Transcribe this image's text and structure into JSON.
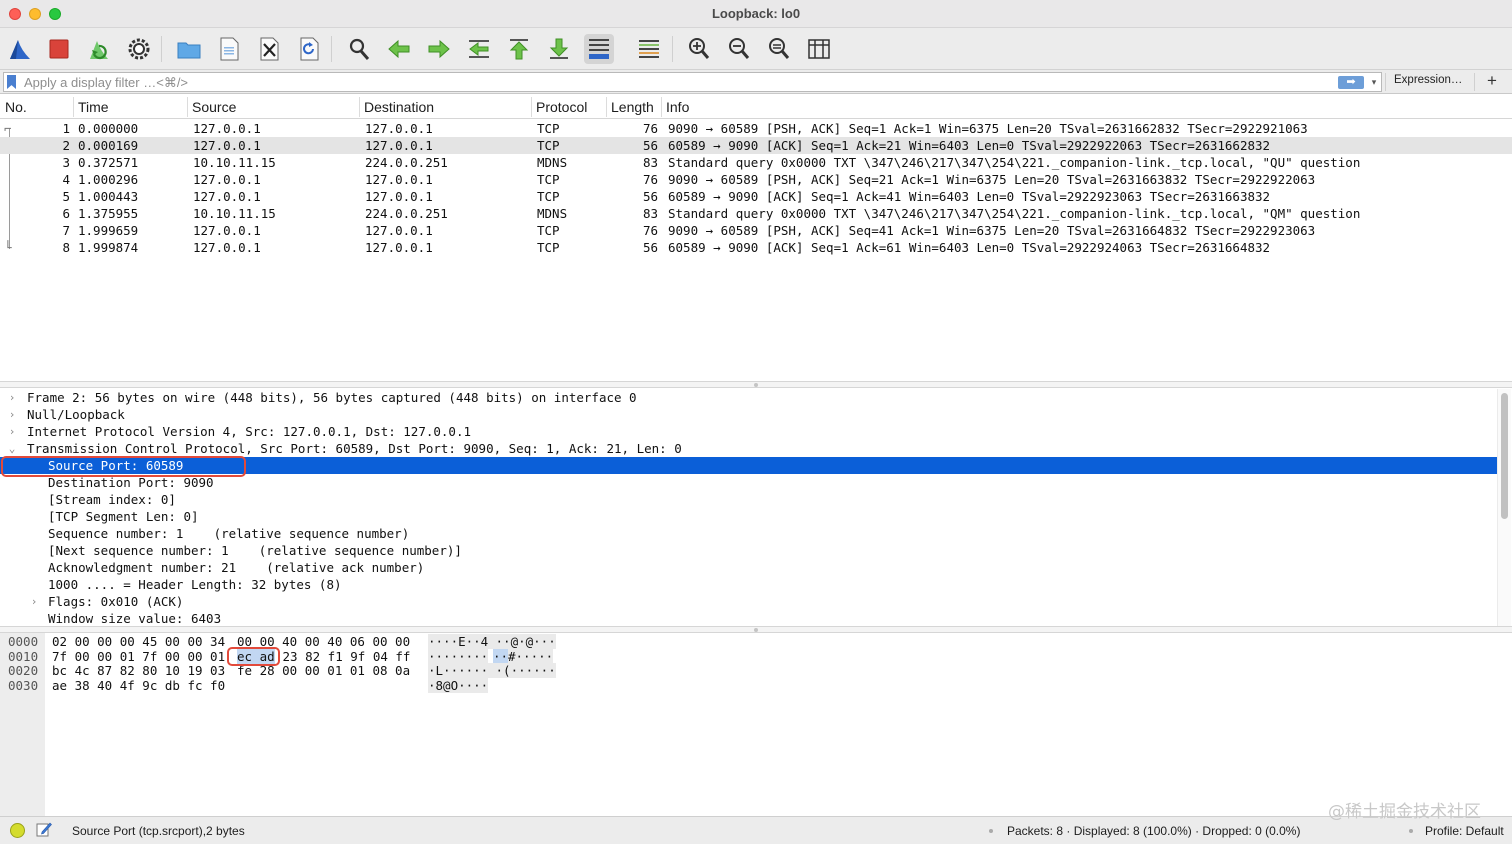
{
  "window": {
    "title": "Loopback: lo0"
  },
  "filter": {
    "placeholder": "Apply a display filter …<⌘/>",
    "value": "",
    "expression_label": "Expression…",
    "add_label": "+",
    "apply_label": "➡",
    "dropdown_label": "▾"
  },
  "packet_list": {
    "columns": [
      "No.",
      "Time",
      "Source",
      "Destination",
      "Protocol",
      "Length",
      "Info"
    ],
    "rows": [
      {
        "no": "1",
        "time": "0.000000",
        "src": "127.0.0.1",
        "dst": "127.0.0.1",
        "proto": "TCP",
        "len": "76",
        "info": "9090 → 60589 [PSH, ACK] Seq=1 Ack=1 Win=6375 Len=20 TSval=2631662832 TSecr=2922921063"
      },
      {
        "no": "2",
        "time": "0.000169",
        "src": "127.0.0.1",
        "dst": "127.0.0.1",
        "proto": "TCP",
        "len": "56",
        "info": "60589 → 9090 [ACK] Seq=1 Ack=21 Win=6403 Len=0 TSval=2922922063 TSecr=2631662832"
      },
      {
        "no": "3",
        "time": "0.372571",
        "src": "10.10.11.15",
        "dst": "224.0.0.251",
        "proto": "MDNS",
        "len": "83",
        "info": "Standard query 0x0000 TXT \\347\\246\\217\\347\\254\\221._companion-link._tcp.local, \"QU\" question"
      },
      {
        "no": "4",
        "time": "1.000296",
        "src": "127.0.0.1",
        "dst": "127.0.0.1",
        "proto": "TCP",
        "len": "76",
        "info": "9090 → 60589 [PSH, ACK] Seq=21 Ack=1 Win=6375 Len=20 TSval=2631663832 TSecr=2922922063"
      },
      {
        "no": "5",
        "time": "1.000443",
        "src": "127.0.0.1",
        "dst": "127.0.0.1",
        "proto": "TCP",
        "len": "56",
        "info": "60589 → 9090 [ACK] Seq=1 Ack=41 Win=6403 Len=0 TSval=2922923063 TSecr=2631663832"
      },
      {
        "no": "6",
        "time": "1.375955",
        "src": "10.10.11.15",
        "dst": "224.0.0.251",
        "proto": "MDNS",
        "len": "83",
        "info": "Standard query 0x0000 TXT \\347\\246\\217\\347\\254\\221._companion-link._tcp.local, \"QM\" question"
      },
      {
        "no": "7",
        "time": "1.999659",
        "src": "127.0.0.1",
        "dst": "127.0.0.1",
        "proto": "TCP",
        "len": "76",
        "info": "9090 → 60589 [PSH, ACK] Seq=41 Ack=1 Win=6375 Len=20 TSval=2631664832 TSecr=2922923063"
      },
      {
        "no": "8",
        "time": "1.999874",
        "src": "127.0.0.1",
        "dst": "127.0.0.1",
        "proto": "TCP",
        "len": "56",
        "info": "60589 → 9090 [ACK] Seq=1 Ack=61 Win=6403 Len=0 TSval=2922924063 TSecr=2631664832"
      }
    ],
    "selected_row": "2"
  },
  "details": {
    "rows": [
      {
        "chev": "›",
        "text": "Frame 2: 56 bytes on wire (448 bits), 56 bytes captured (448 bits) on interface 0"
      },
      {
        "chev": "›",
        "text": "Null/Loopback"
      },
      {
        "chev": "›",
        "text": "Internet Protocol Version 4, Src: 127.0.0.1, Dst: 127.0.0.1"
      },
      {
        "chev": "⌄",
        "text": "Transmission Control Protocol, Src Port: 60589, Dst Port: 9090, Seq: 1, Ack: 21, Len: 0"
      },
      {
        "chev": "",
        "text": "Source Port: 60589"
      },
      {
        "chev": "",
        "text": "Destination Port: 9090"
      },
      {
        "chev": "",
        "text": "[Stream index: 0]"
      },
      {
        "chev": "",
        "text": "[TCP Segment Len: 0]"
      },
      {
        "chev": "",
        "text": "Sequence number: 1    (relative sequence number)"
      },
      {
        "chev": "",
        "text": "[Next sequence number: 1    (relative sequence number)]"
      },
      {
        "chev": "",
        "text": "Acknowledgment number: 21    (relative ack number)"
      },
      {
        "chev": "",
        "text": "1000 .... = Header Length: 32 bytes (8)"
      },
      {
        "chev": "›",
        "text": "Flags: 0x010 (ACK)"
      },
      {
        "chev": "",
        "text": "Window size value: 6403"
      }
    ]
  },
  "bytes": {
    "rows": [
      {
        "offset": "0000",
        "hex_a": "02 00 00 00 45 00 00 34",
        "hex_b_pre": "",
        "hex_b_hl": "",
        "hex_b_post": "00 00 40 00 40 06 00 00",
        "ascii_pre": "····E··4",
        "ascii_hl": "",
        "ascii_post": " ··@·@···"
      },
      {
        "offset": "0010",
        "hex_a": "7f 00 00 01 7f 00 00 01",
        "hex_b_pre": "",
        "hex_b_hl": "ec ad",
        "hex_b_post": " 23 82 f1 9f 04 ff",
        "ascii_pre": "········",
        "ascii_hl": "··",
        "ascii_post": "#·····"
      },
      {
        "offset": "0020",
        "hex_a": "bc 4c 87 82 80 10 19 03",
        "hex_b_pre": "",
        "hex_b_hl": "",
        "hex_b_post": "fe 28 00 00 01 01 08 0a",
        "ascii_pre": "·L······",
        "ascii_hl": "",
        "ascii_post": " ·(······"
      },
      {
        "offset": "0030",
        "hex_a": "ae 38 40 4f 9c db fc f0",
        "hex_b_pre": "",
        "hex_b_hl": "",
        "hex_b_post": "",
        "ascii_pre": "·8@O····",
        "ascii_hl": "",
        "ascii_post": ""
      }
    ]
  },
  "status": {
    "field_info": "Source Port (tcp.srcport),2 bytes",
    "packets": "Packets: 8 · Displayed: 8 (100.0%) · Dropped: 0 (0.0%)",
    "profile": "Profile: Default"
  },
  "watermark": "@稀土掘金技术社区",
  "colors": {
    "selection_blue": "#0b5fd8",
    "annotation_red": "#e24a3b",
    "accent_shark": "#2e66c8"
  },
  "toolbar": {
    "icons": [
      "shark-fin-icon",
      "stop-icon",
      "restart-icon",
      "options-gear-icon",
      "open-folder-icon",
      "save-file-icon",
      "close-file-icon",
      "reload-icon",
      "find-icon",
      "go-back-icon",
      "go-forward-icon",
      "go-to-packet-icon",
      "go-first-icon",
      "go-last-icon",
      "autoscroll-icon",
      "colorize-icon",
      "zoom-in-icon",
      "zoom-out-icon",
      "zoom-normal-icon",
      "resize-columns-icon"
    ]
  }
}
